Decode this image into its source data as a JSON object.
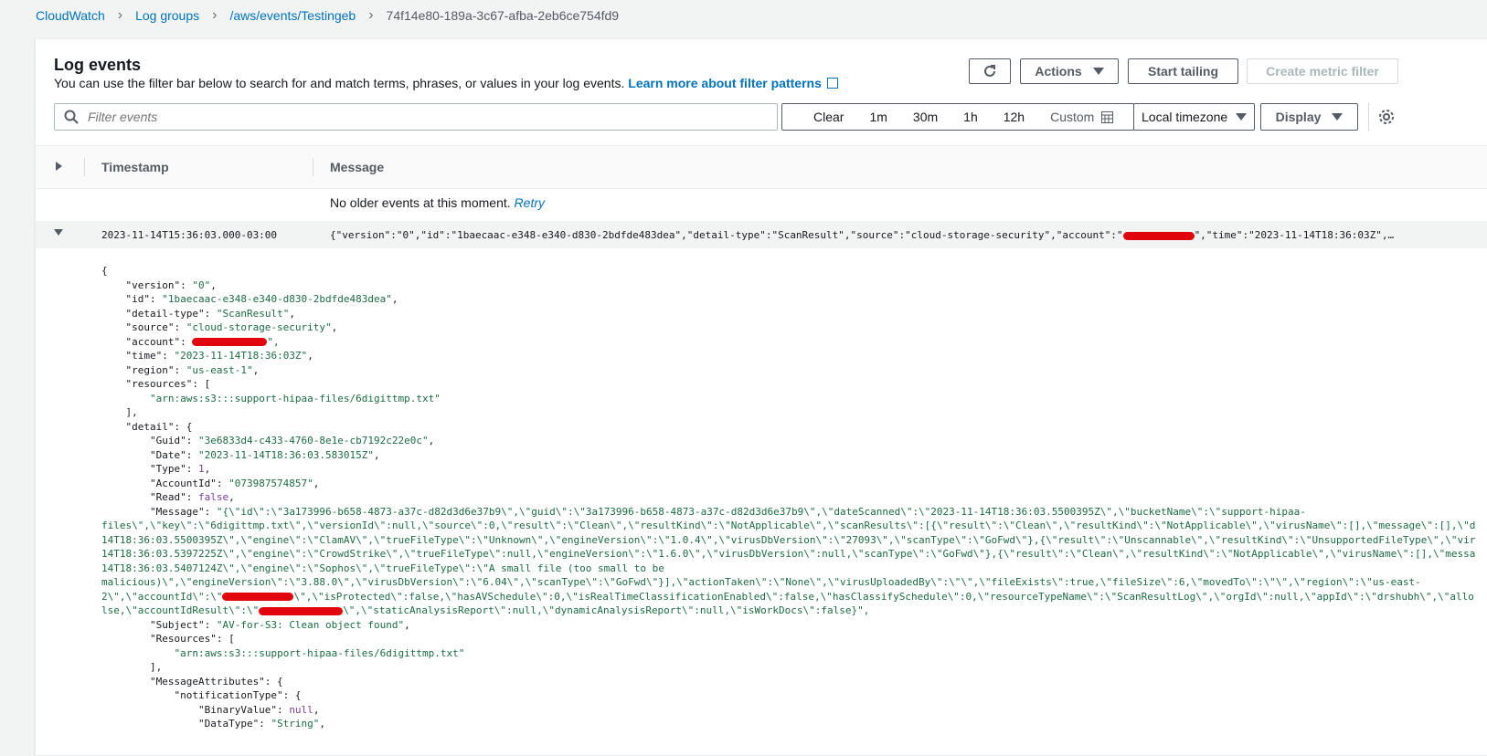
{
  "breadcrumb": {
    "items": [
      "CloudWatch",
      "Log groups",
      "/aws/events/Testingeb"
    ],
    "current": "74f14e80-189a-3c67-afba-2eb6ce754fd9"
  },
  "panel": {
    "title": "Log events",
    "description": "You can use the filter bar below to search for and match terms, phrases, or values in your log events.",
    "learn_more": "Learn more about filter patterns"
  },
  "toolbar": {
    "actions": "Actions",
    "start_tailing": "Start tailing",
    "create_metric_filter": "Create metric filter"
  },
  "filter": {
    "placeholder": "Filter events",
    "clear": "Clear",
    "ranges": [
      "1m",
      "30m",
      "1h",
      "12h"
    ],
    "custom": "Custom",
    "timezone": "Local timezone",
    "display": "Display"
  },
  "table": {
    "col_timestamp": "Timestamp",
    "col_message": "Message",
    "no_older": "No older events at this moment.",
    "retry": "Retry"
  },
  "event": {
    "timestamp": "2023-11-14T15:36:03.000-03:00",
    "message_prefix": "{\"version\":\"0\",\"id\":\"1baecaac-e348-e340-d830-2bdfde483dea\",\"detail-type\":\"ScanResult\",\"source\":\"cloud-storage-security\",\"account\":\"",
    "message_suffix": "\",\"time\":\"2023-11-14T18:36:03Z\",\"region\"…"
  },
  "json": {
    "version": "\"0\"",
    "id": "\"1baecaac-e348-e340-d830-2bdfde483dea\"",
    "detail_type": "\"ScanResult\"",
    "source": "\"cloud-storage-security\"",
    "account_suffix": "\",",
    "time": "\"2023-11-14T18:36:03Z\"",
    "region": "\"us-east-1\"",
    "resource": "\"arn:aws:s3:::support-hipaa-files/6digittmp.txt\"",
    "guid": "\"3e6833d4-c433-4760-8e1e-cb7192c22e0c\"",
    "date": "\"2023-11-14T18:36:03.583015Z\"",
    "type": "1",
    "account_id": "\"073987574857\"",
    "read": "false",
    "message_lines": [
      "\"{\\\"id\\\":\\\"3a173996-b658-4873-a37c-d82d3d6e37b9\\\",\\\"guid\\\":\\\"3a173996-b658-4873-a37c-d82d3d6e37b9\\\",\\\"dateScanned\\\":\\\"2023-11-14T18:36:03.5500395Z\\\",\\\"bucketName\\\":\\\"support-hipaa-",
      "files\\\",\\\"key\\\":\\\"6digittmp.txt\\\",\\\"versionId\\\":null,\\\"source\\\":0,\\\"result\\\":\\\"Clean\\\",\\\"resultKind\\\":\\\"NotApplicable\\\",\\\"scanResults\\\":[{\\\"result\\\":\\\"Clean\\\",\\\"resultKind\\\":\\\"NotApplicable\\\",\\\"virusName\\\":[],\\\"message\\\":[],\\\"d",
      "14T18:36:03.5500395Z\\\",\\\"engine\\\":\\\"ClamAV\\\",\\\"trueFileType\\\":\\\"Unknown\\\",\\\"engineVersion\\\":\\\"1.0.4\\\",\\\"virusDbVersion\\\":\\\"27093\\\",\\\"scanType\\\":\\\"GoFwd\\\"},{\\\"result\\\":\\\"Unscannable\\\",\\\"resultKind\\\":\\\"UnsupportedFileType\\\",\\\"vir",
      "14T18:36:03.5397225Z\\\",\\\"engine\\\":\\\"CrowdStrike\\\",\\\"trueFileType\\\":null,\\\"engineVersion\\\":\\\"1.6.0\\\",\\\"virusDbVersion\\\":null,\\\"scanType\\\":\\\"GoFwd\\\"},{\\\"result\\\":\\\"Clean\\\",\\\"resultKind\\\":\\\"NotApplicable\\\",\\\"virusName\\\":[],\\\"messa",
      "14T18:36:03.5407124Z\\\",\\\"engine\\\":\\\"Sophos\\\",\\\"trueFileType\\\":\\\"A small file (too small to be",
      "malicious)\\\",\\\"engineVersion\\\":\\\"3.88.0\\\",\\\"virusDbVersion\\\":\\\"6.04\\\",\\\"scanType\\\":\\\"GoFwd\\\"}],\\\"actionTaken\\\":\\\"None\\\",\\\"virusUploadedBy\\\":\\\"\\\",\\\"fileExists\\\":true,\\\"fileSize\\\":6,\\\"movedTo\\\":\\\"\\\",\\\"region\\\":\\\"us-east-"
    ],
    "message_line7_prefix": "2\\\",\\\"accountId\\\":\\\"",
    "message_line7_suffix": "\\\",\\\"isProtected\\\":false,\\\"hasAVSchedule\\\":0,\\\"isRealTimeClassificationEnabled\\\":false,\\\"hasClassifySchedule\\\":0,\\\"resourceTypeName\\\":\\\"ScanResultLog\\\",\\\"orgId\\\":null,\\\"appId\\\":\\\"drshubh\\\",\\\"allo",
    "message_line8_prefix": "lse,\\\"accountIdResult\\\":\\\"",
    "message_line8_suffix": "\\\",\\\"staticAnalysisReport\\\":null,\\\"dynamicAnalysisReport\\\":null,\\\"isWorkDocs\\\":false}\",",
    "subject": "\"AV-for-S3: Clean object found\"",
    "notif_resource": "\"arn:aws:s3:::support-hipaa-files/6digittmp.txt\"",
    "binary_value": "null",
    "data_type": "\"String\""
  },
  "colors": {
    "link": "#0073bb",
    "redaction": "#e0060b",
    "string": "#1d6b43"
  }
}
